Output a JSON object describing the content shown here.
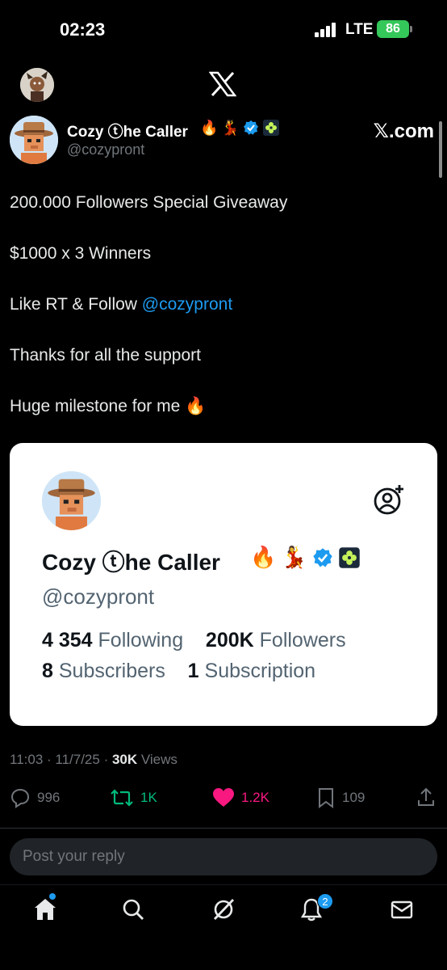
{
  "status_bar": {
    "time": "02:23",
    "network": "LTE",
    "battery": "86"
  },
  "header": {
    "avatar_icon": "user-avatar-icon",
    "logo": "x-logo-icon"
  },
  "tweet": {
    "display_name": "Cozy ⓣhe Caller",
    "name_emojis": [
      "🔥",
      "💃"
    ],
    "handle": "@cozypront",
    "source": "𝕏.com",
    "lines": [
      "200.000 Followers Special Giveaway",
      "$1000 x 3 Winners",
      "Like RT & Follow ",
      "Thanks for all the support",
      "Huge milestone for me 🔥"
    ],
    "mention": "@cozypront",
    "time": "11:03 · 11/7/25 · ",
    "views_count": "30K",
    "views_label": " Views",
    "actions": {
      "replies": "996",
      "reposts": "1K",
      "likes": "1.2K",
      "bookmarks": "109"
    }
  },
  "card": {
    "name": "Cozy ⓣhe Caller",
    "emojis": [
      "🔥",
      "💃"
    ],
    "handle": "@cozypront",
    "following_count": "4 354",
    "following_label": "Following",
    "followers_count": "200K",
    "followers_label": "Followers",
    "subscribers_count": "8",
    "subscribers_label": "Subscribers",
    "subscription_count": "1",
    "subscription_label": "Subscription"
  },
  "reply": {
    "placeholder": "Post your reply"
  },
  "nav": {
    "notifications_badge": "2"
  },
  "colors": {
    "accent": "#1d9bf0",
    "like": "#f91880",
    "repost": "#00ba7c",
    "verified": "#1d9bf0",
    "battery": "#34c759"
  }
}
